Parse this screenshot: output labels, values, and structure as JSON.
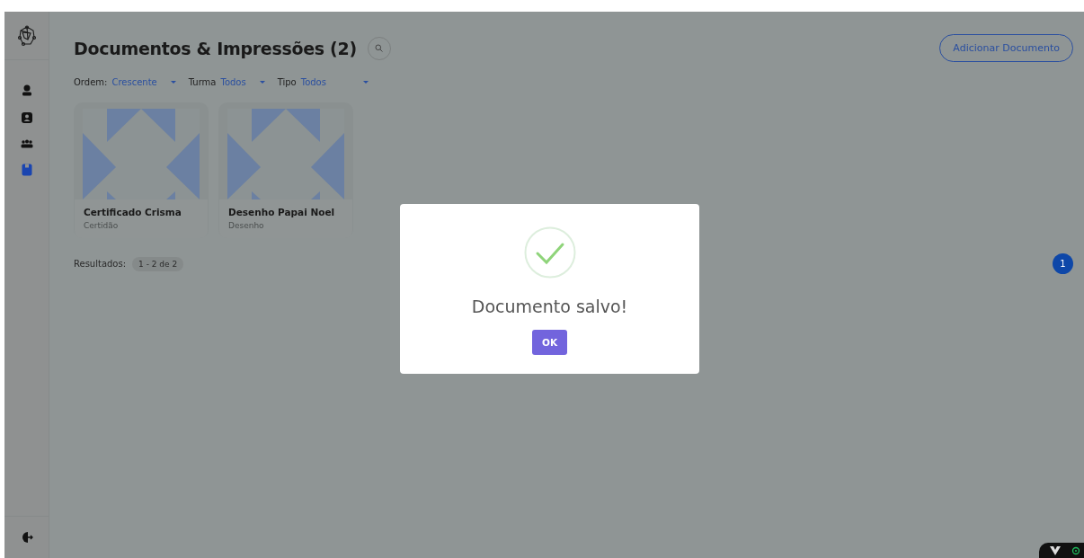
{
  "sidebar": {
    "items": [
      {
        "kind": "user",
        "selected": false
      },
      {
        "kind": "contact",
        "selected": false
      },
      {
        "kind": "group",
        "selected": false
      },
      {
        "kind": "book",
        "selected": true
      }
    ]
  },
  "header": {
    "title": "Documentos & Impressões (2)",
    "add_button": "Adicionar Documento"
  },
  "filters": [
    {
      "label": "Ordem:",
      "value": "Crescente"
    },
    {
      "label": "Turma",
      "value": "Todos"
    },
    {
      "label": "Tipo",
      "value": "Todos"
    }
  ],
  "cards": [
    {
      "title": "Certificado Crisma",
      "type": "Certidão"
    },
    {
      "title": "Desenho Papai Noel",
      "type": "Desenho"
    }
  ],
  "results": {
    "label": "Resultados:",
    "range": "1 - 2 de 2"
  },
  "pagination": [
    {
      "label": "1",
      "selected": true
    }
  ],
  "dialog": {
    "message": "Documento salvo!",
    "button": "OK"
  }
}
